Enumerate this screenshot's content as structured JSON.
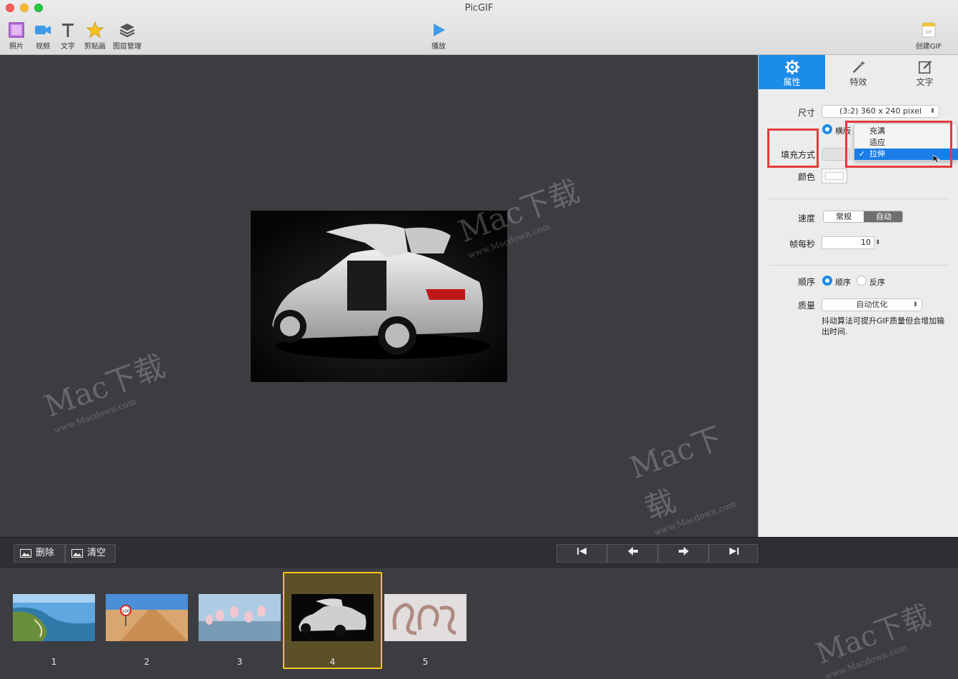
{
  "window": {
    "title": "PicGIF"
  },
  "toolbar": {
    "photo": "照片",
    "video": "视频",
    "text": "文字",
    "clipart": "剪贴画",
    "layers": "图层管理",
    "play": "播放",
    "create": "创建GIF",
    "create_badge": "GIF"
  },
  "panel": {
    "tabs": {
      "properties": "属性",
      "effects": "特效",
      "text": "文字"
    },
    "size_label": "尺寸",
    "size_value": "(3:2) 360 x 240 pixel",
    "orientation_label": "横版",
    "fill_label": "填充方式",
    "color_label": "颜色",
    "speed_label": "速度",
    "speed_options": [
      "常规",
      "自动"
    ],
    "fps_label": "帧每秒",
    "fps_value": "10",
    "order_label": "顺序",
    "order_forward": "顺序",
    "order_reverse": "反序",
    "quality_label": "质量",
    "quality_value": "自动优化",
    "quality_note": "抖动算法可提升GIF质量但会增加输出时间."
  },
  "fill_menu": {
    "items": [
      "充满",
      "适应",
      "拉伸"
    ],
    "selected": "拉伸"
  },
  "bottom": {
    "delete": "删除",
    "clear": "清空"
  },
  "frames": [
    {
      "number": "1"
    },
    {
      "number": "2",
      "sign": "100"
    },
    {
      "number": "3"
    },
    {
      "number": "4"
    },
    {
      "number": "5"
    }
  ],
  "selected_frame": "4",
  "watermark": {
    "brand": "Mac下载",
    "url": "www.Macdown.com"
  },
  "colors": {
    "accent": "#1b8cea",
    "highlight": "#e53b3b",
    "selected_frame_border": "#f2c51a"
  }
}
